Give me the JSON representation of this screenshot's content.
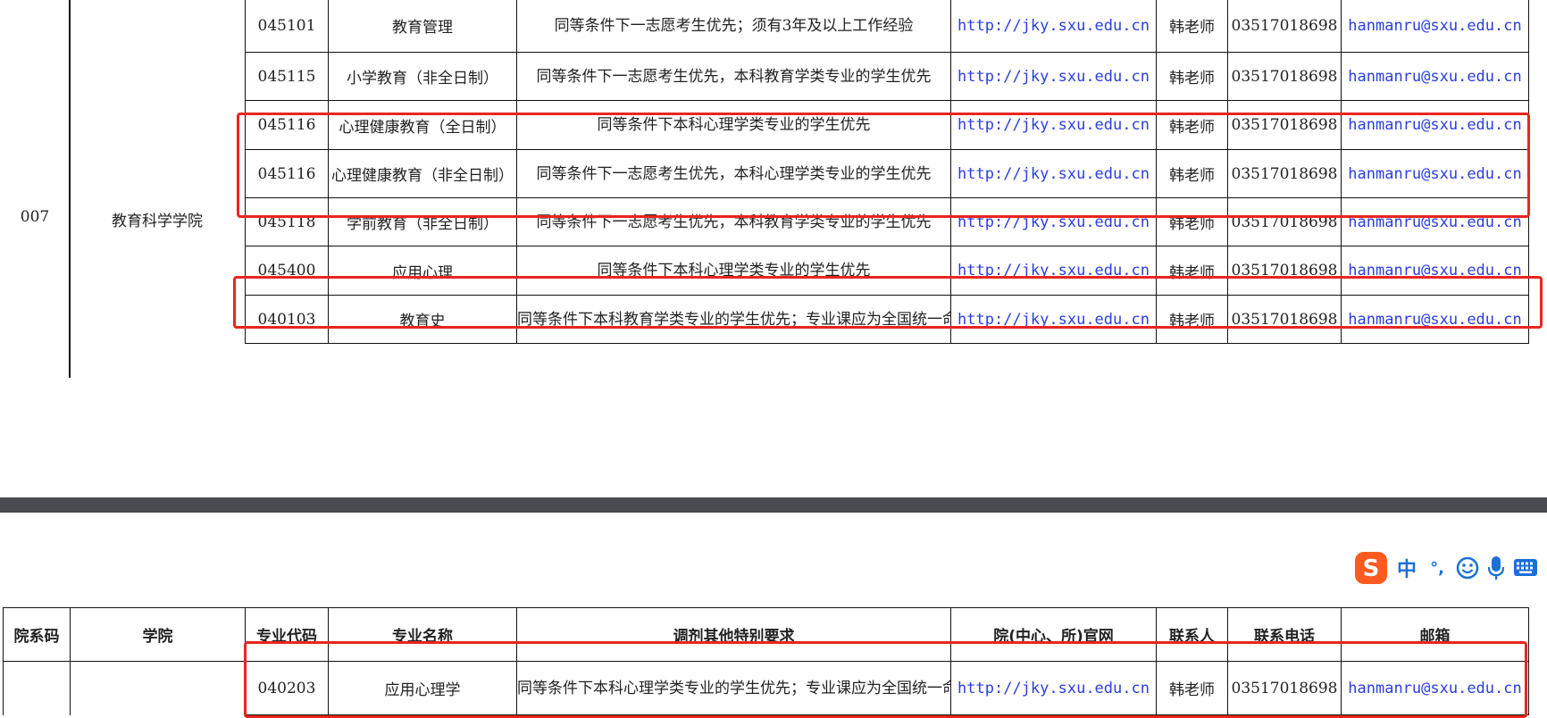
{
  "top_table": {
    "dept_code": "007",
    "college": "教育科学学院",
    "rows": [
      {
        "code": "045101",
        "name": "教育管理",
        "req": "同等条件下一志愿考生优先；须有3年及以上工作经验",
        "url": "http://jky.sxu.edu.cn",
        "contact": "韩老师",
        "phone": "03517018698",
        "email": "hanmanru@sxu.edu.cn"
      },
      {
        "code": "045115",
        "name": "小学教育（非全日制）",
        "req": "同等条件下一志愿考生优先，本科教育学类专业的学生优先",
        "url": "http://jky.sxu.edu.cn",
        "contact": "韩老师",
        "phone": "03517018698",
        "email": "hanmanru@sxu.edu.cn"
      },
      {
        "code": "045116",
        "name": "心理健康教育（全日制）",
        "req": "同等条件下本科心理学类专业的学生优先",
        "url": "http://jky.sxu.edu.cn",
        "contact": "韩老师",
        "phone": "03517018698",
        "email": "hanmanru@sxu.edu.cn"
      },
      {
        "code": "045116",
        "name": "心理健康教育（非全日制）",
        "req": "同等条件下一志愿考生优先，本科心理学类专业的学生优先",
        "url": "http://jky.sxu.edu.cn",
        "contact": "韩老师",
        "phone": "03517018698",
        "email": "hanmanru@sxu.edu.cn"
      },
      {
        "code": "045118",
        "name": "学前教育（非全日制）",
        "req": "同等条件下一志愿考生优先，本科教育学类专业的学生优先",
        "url": "http://jky.sxu.edu.cn",
        "contact": "韩老师",
        "phone": "03517018698",
        "email": "hanmanru@sxu.edu.cn"
      },
      {
        "code": "045400",
        "name": "应用心理",
        "req": "同等条件下本科心理学类专业的学生优先",
        "url": "http://jky.sxu.edu.cn",
        "contact": "韩老师",
        "phone": "03517018698",
        "email": "hanmanru@sxu.edu.cn"
      },
      {
        "code": "040103",
        "name": "教育史",
        "req": "同等条件下本科教育学类专业的学生优先；专业课应为全国统一命题科目",
        "url": "http://jky.sxu.edu.cn",
        "contact": "韩老师",
        "phone": "03517018698",
        "email": "hanmanru@sxu.edu.cn"
      }
    ]
  },
  "bottom_table": {
    "headers": [
      "院系码",
      "学院",
      "专业代码",
      "专业名称",
      "调剂其他特别要求",
      "院(中心、所)官网",
      "联系人",
      "联系电话",
      "邮箱"
    ],
    "rows": [
      {
        "code": "040203",
        "name": "应用心理学",
        "req": "同等条件下本科心理学类专业的学生优先；专业课应为全国统一命题科目",
        "url": "http://jky.sxu.edu.cn",
        "contact": "韩老师",
        "phone": "03517018698",
        "email": "hanmanru@sxu.edu.cn"
      }
    ]
  },
  "ime_toolbar": {
    "mode_label": "中",
    "punct_label": "°,",
    "colors": {
      "logo": "#ff5a1f",
      "icons": "#1a6fd8"
    }
  },
  "highlight_color": "#e8261f"
}
